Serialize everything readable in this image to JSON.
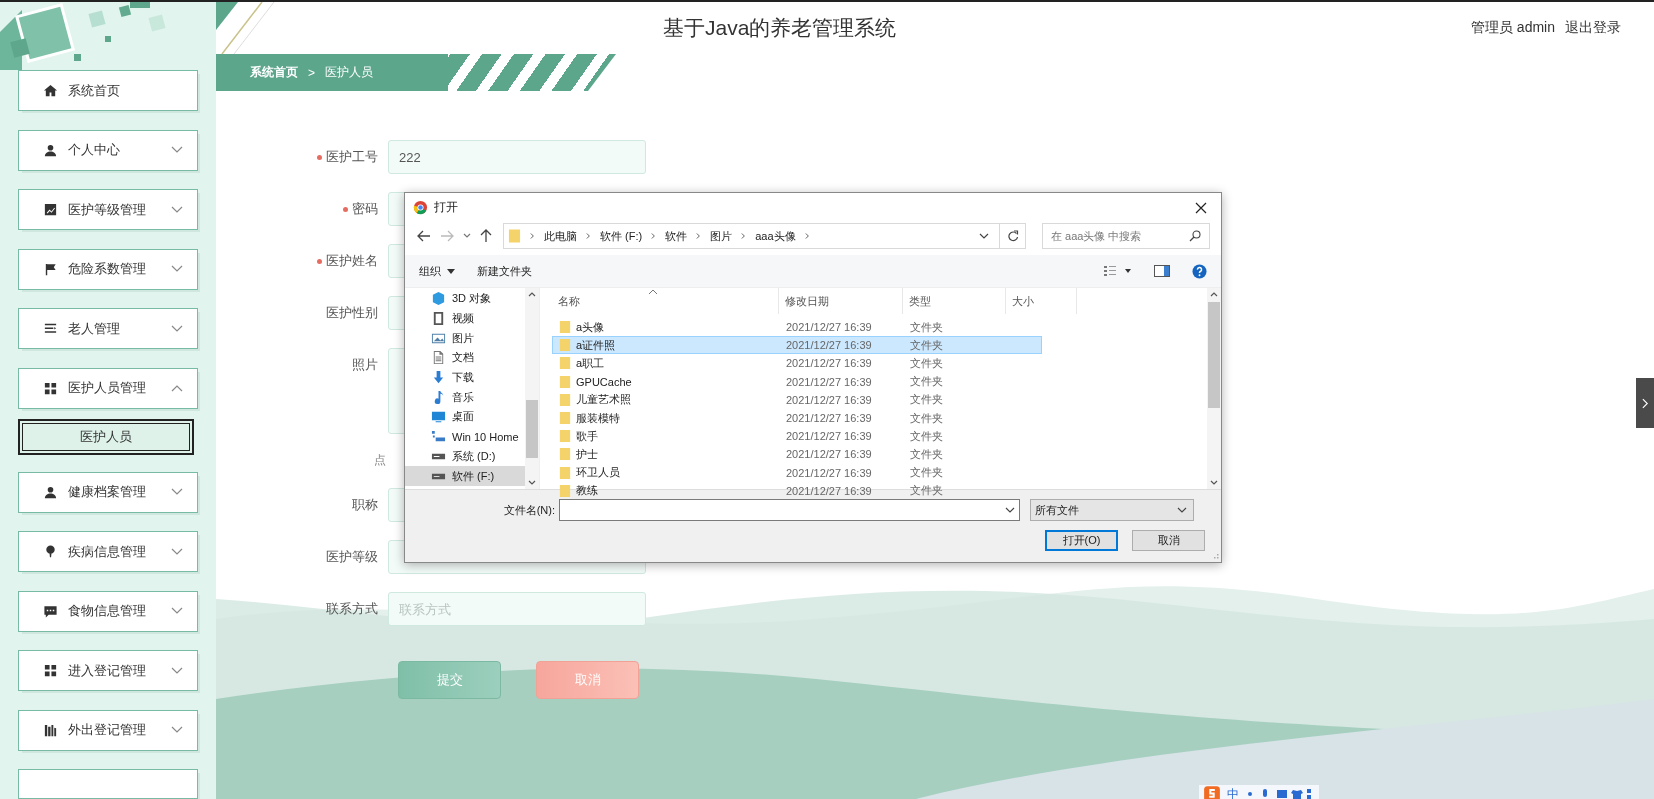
{
  "header": {
    "title": "基于Java的养老管理系统",
    "user": "管理员 admin",
    "logout": "退出登录"
  },
  "breadcrumb": {
    "items": [
      "系统首页",
      "医护人员"
    ],
    "separator": ">"
  },
  "sidebar": {
    "items": [
      {
        "label": "系统首页",
        "kind": "link"
      },
      {
        "label": "个人中心",
        "kind": "group",
        "expanded": false
      },
      {
        "label": "医护等级管理",
        "kind": "group",
        "expanded": false
      },
      {
        "label": "危险系数管理",
        "kind": "group",
        "expanded": false
      },
      {
        "label": "老人管理",
        "kind": "group",
        "expanded": false
      },
      {
        "label": "医护人员管理",
        "kind": "group",
        "expanded": true,
        "children": [
          {
            "label": "医护人员",
            "selected": true
          }
        ]
      },
      {
        "label": "健康档案管理",
        "kind": "group",
        "expanded": false
      },
      {
        "label": "疾病信息管理",
        "kind": "group",
        "expanded": false
      },
      {
        "label": "食物信息管理",
        "kind": "group",
        "expanded": false
      },
      {
        "label": "进入登记管理",
        "kind": "group",
        "expanded": false
      },
      {
        "label": "外出登记管理",
        "kind": "group",
        "expanded": false
      }
    ]
  },
  "form": {
    "fields": [
      {
        "label": "医护工号",
        "required": true,
        "kind": "text",
        "value": "222"
      },
      {
        "label": "密码",
        "required": true,
        "kind": "text"
      },
      {
        "label": "医护姓名",
        "required": true,
        "kind": "text"
      },
      {
        "label": "医护性别",
        "required": false,
        "kind": "text"
      },
      {
        "label": "照片",
        "required": false,
        "kind": "upload",
        "hint": "点"
      },
      {
        "label": "职称",
        "required": false,
        "kind": "text"
      },
      {
        "label": "医护等级",
        "required": false,
        "kind": "text"
      },
      {
        "label": "联系方式",
        "required": false,
        "kind": "text",
        "placeholder": "联系方式"
      }
    ],
    "buttons": [
      {
        "label": "提交",
        "kind": "submit"
      },
      {
        "label": "取消",
        "kind": "cancel"
      }
    ]
  },
  "dialog": {
    "title": "打开",
    "path": [
      "此电脑",
      "软件 (F:)",
      "软件",
      "图片",
      "aaa头像"
    ],
    "search": {
      "placeholder": "在 aaa头像 中搜索"
    },
    "toolbar": [
      "组织",
      "新建文件夹"
    ],
    "nav": [
      {
        "label": "3D 对象",
        "selected": false
      },
      {
        "label": "视频",
        "selected": false
      },
      {
        "label": "图片",
        "selected": false
      },
      {
        "label": "文档",
        "selected": false
      },
      {
        "label": "下载",
        "selected": false
      },
      {
        "label": "音乐",
        "selected": false
      },
      {
        "label": "桌面",
        "selected": false
      },
      {
        "label": "Win 10 Home",
        "selected": false
      },
      {
        "label": "系统 (D:)",
        "selected": false
      },
      {
        "label": "软件 (F:)",
        "selected": true
      }
    ],
    "columns": [
      "名称",
      "修改日期",
      "类型",
      "大小"
    ],
    "rows": [
      {
        "name": "a头像",
        "modified": "2021/12/27 16:39",
        "type": "文件夹",
        "selected": false
      },
      {
        "name": "a证件照",
        "modified": "2021/12/27 16:39",
        "type": "文件夹",
        "selected": true
      },
      {
        "name": "a职工",
        "modified": "2021/12/27 16:39",
        "type": "文件夹",
        "selected": false
      },
      {
        "name": "GPUCache",
        "modified": "2021/12/27 16:39",
        "type": "文件夹",
        "selected": false
      },
      {
        "name": "儿童艺术照",
        "modified": "2021/12/27 16:39",
        "type": "文件夹",
        "selected": false
      },
      {
        "name": "服装模特",
        "modified": "2021/12/27 16:39",
        "type": "文件夹",
        "selected": false
      },
      {
        "name": "歌手",
        "modified": "2021/12/27 16:39",
        "type": "文件夹",
        "selected": false
      },
      {
        "name": "护士",
        "modified": "2021/12/27 16:39",
        "type": "文件夹",
        "selected": false
      },
      {
        "name": "环卫人员",
        "modified": "2021/12/27 16:39",
        "type": "文件夹",
        "selected": false
      },
      {
        "name": "教练",
        "modified": "2021/12/27 16:39",
        "type": "文件夹",
        "selected": false
      }
    ],
    "filename_label": "文件名(N):",
    "filter": "所有文件",
    "buttons": [
      {
        "label": "打开(O)",
        "kind": "default"
      },
      {
        "label": "取消",
        "kind": "normal"
      }
    ]
  },
  "ime": {
    "label": "中"
  }
}
